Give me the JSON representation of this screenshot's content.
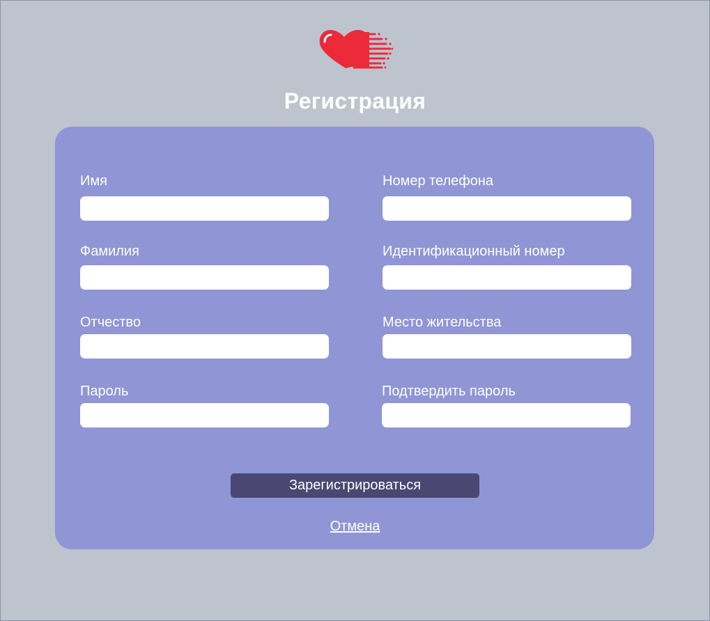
{
  "brand": {
    "logo_icon": "speeding-heart-icon",
    "logo_color": "#ec2a3a"
  },
  "page": {
    "title": "Регистрация"
  },
  "form": {
    "fields": {
      "first_name": {
        "label": "Имя",
        "value": "",
        "placeholder": ""
      },
      "last_name": {
        "label": "Фамилия",
        "value": "",
        "placeholder": ""
      },
      "patronymic": {
        "label": "Отчество",
        "value": "",
        "placeholder": ""
      },
      "password": {
        "label": "Пароль",
        "value": "",
        "placeholder": ""
      },
      "phone": {
        "label": "Номер телефона",
        "value": "",
        "placeholder": ""
      },
      "id_number": {
        "label": "Идентификационный номер",
        "value": "",
        "placeholder": ""
      },
      "residence": {
        "label": "Место жительства",
        "value": "",
        "placeholder": ""
      },
      "confirm_password": {
        "label": "Подтвердить пароль",
        "value": "",
        "placeholder": ""
      }
    },
    "submit_label": "Зарегистрироваться",
    "cancel_label": "Отмена"
  },
  "colors": {
    "background": "#bec4ce",
    "card": "#8f95d5",
    "button": "#4a4772",
    "text": "#ffffff"
  }
}
